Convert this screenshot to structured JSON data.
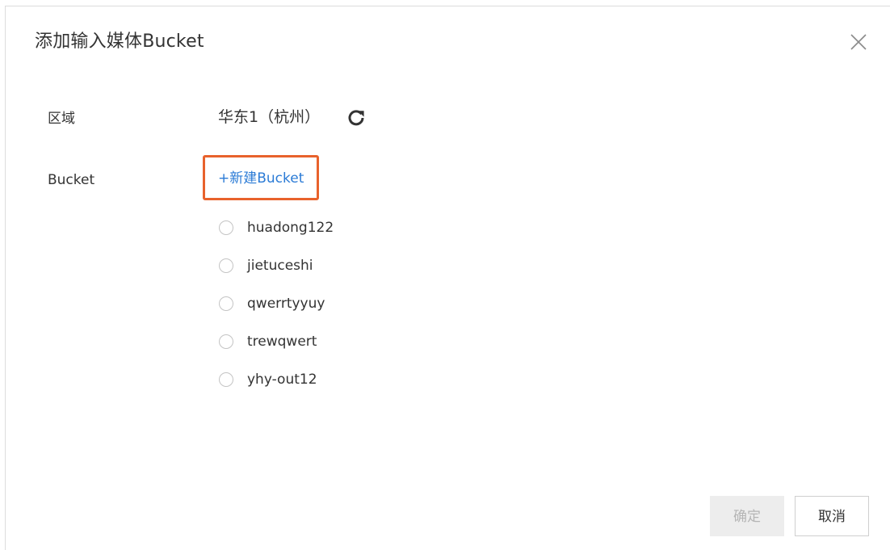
{
  "dialog": {
    "title": "添加输入媒体Bucket",
    "close_icon": "close-icon"
  },
  "region": {
    "label": "区域",
    "value": "华东1（杭州）",
    "refresh_icon": "refresh-icon"
  },
  "bucket": {
    "label": "Bucket",
    "new_link": "+新建Bucket",
    "options": [
      {
        "label": "huadong122",
        "selected": false
      },
      {
        "label": "jietuceshi",
        "selected": false
      },
      {
        "label": "qwerrtyyuy",
        "selected": false
      },
      {
        "label": "trewqwert",
        "selected": false
      },
      {
        "label": "yhy-out12",
        "selected": false
      }
    ]
  },
  "footer": {
    "confirm_label": "确定",
    "cancel_label": "取消"
  },
  "colors": {
    "link": "#2b7bd6",
    "highlight_border": "#e8622c",
    "disabled_bg": "#ededed",
    "disabled_text": "#b5b5b5"
  }
}
